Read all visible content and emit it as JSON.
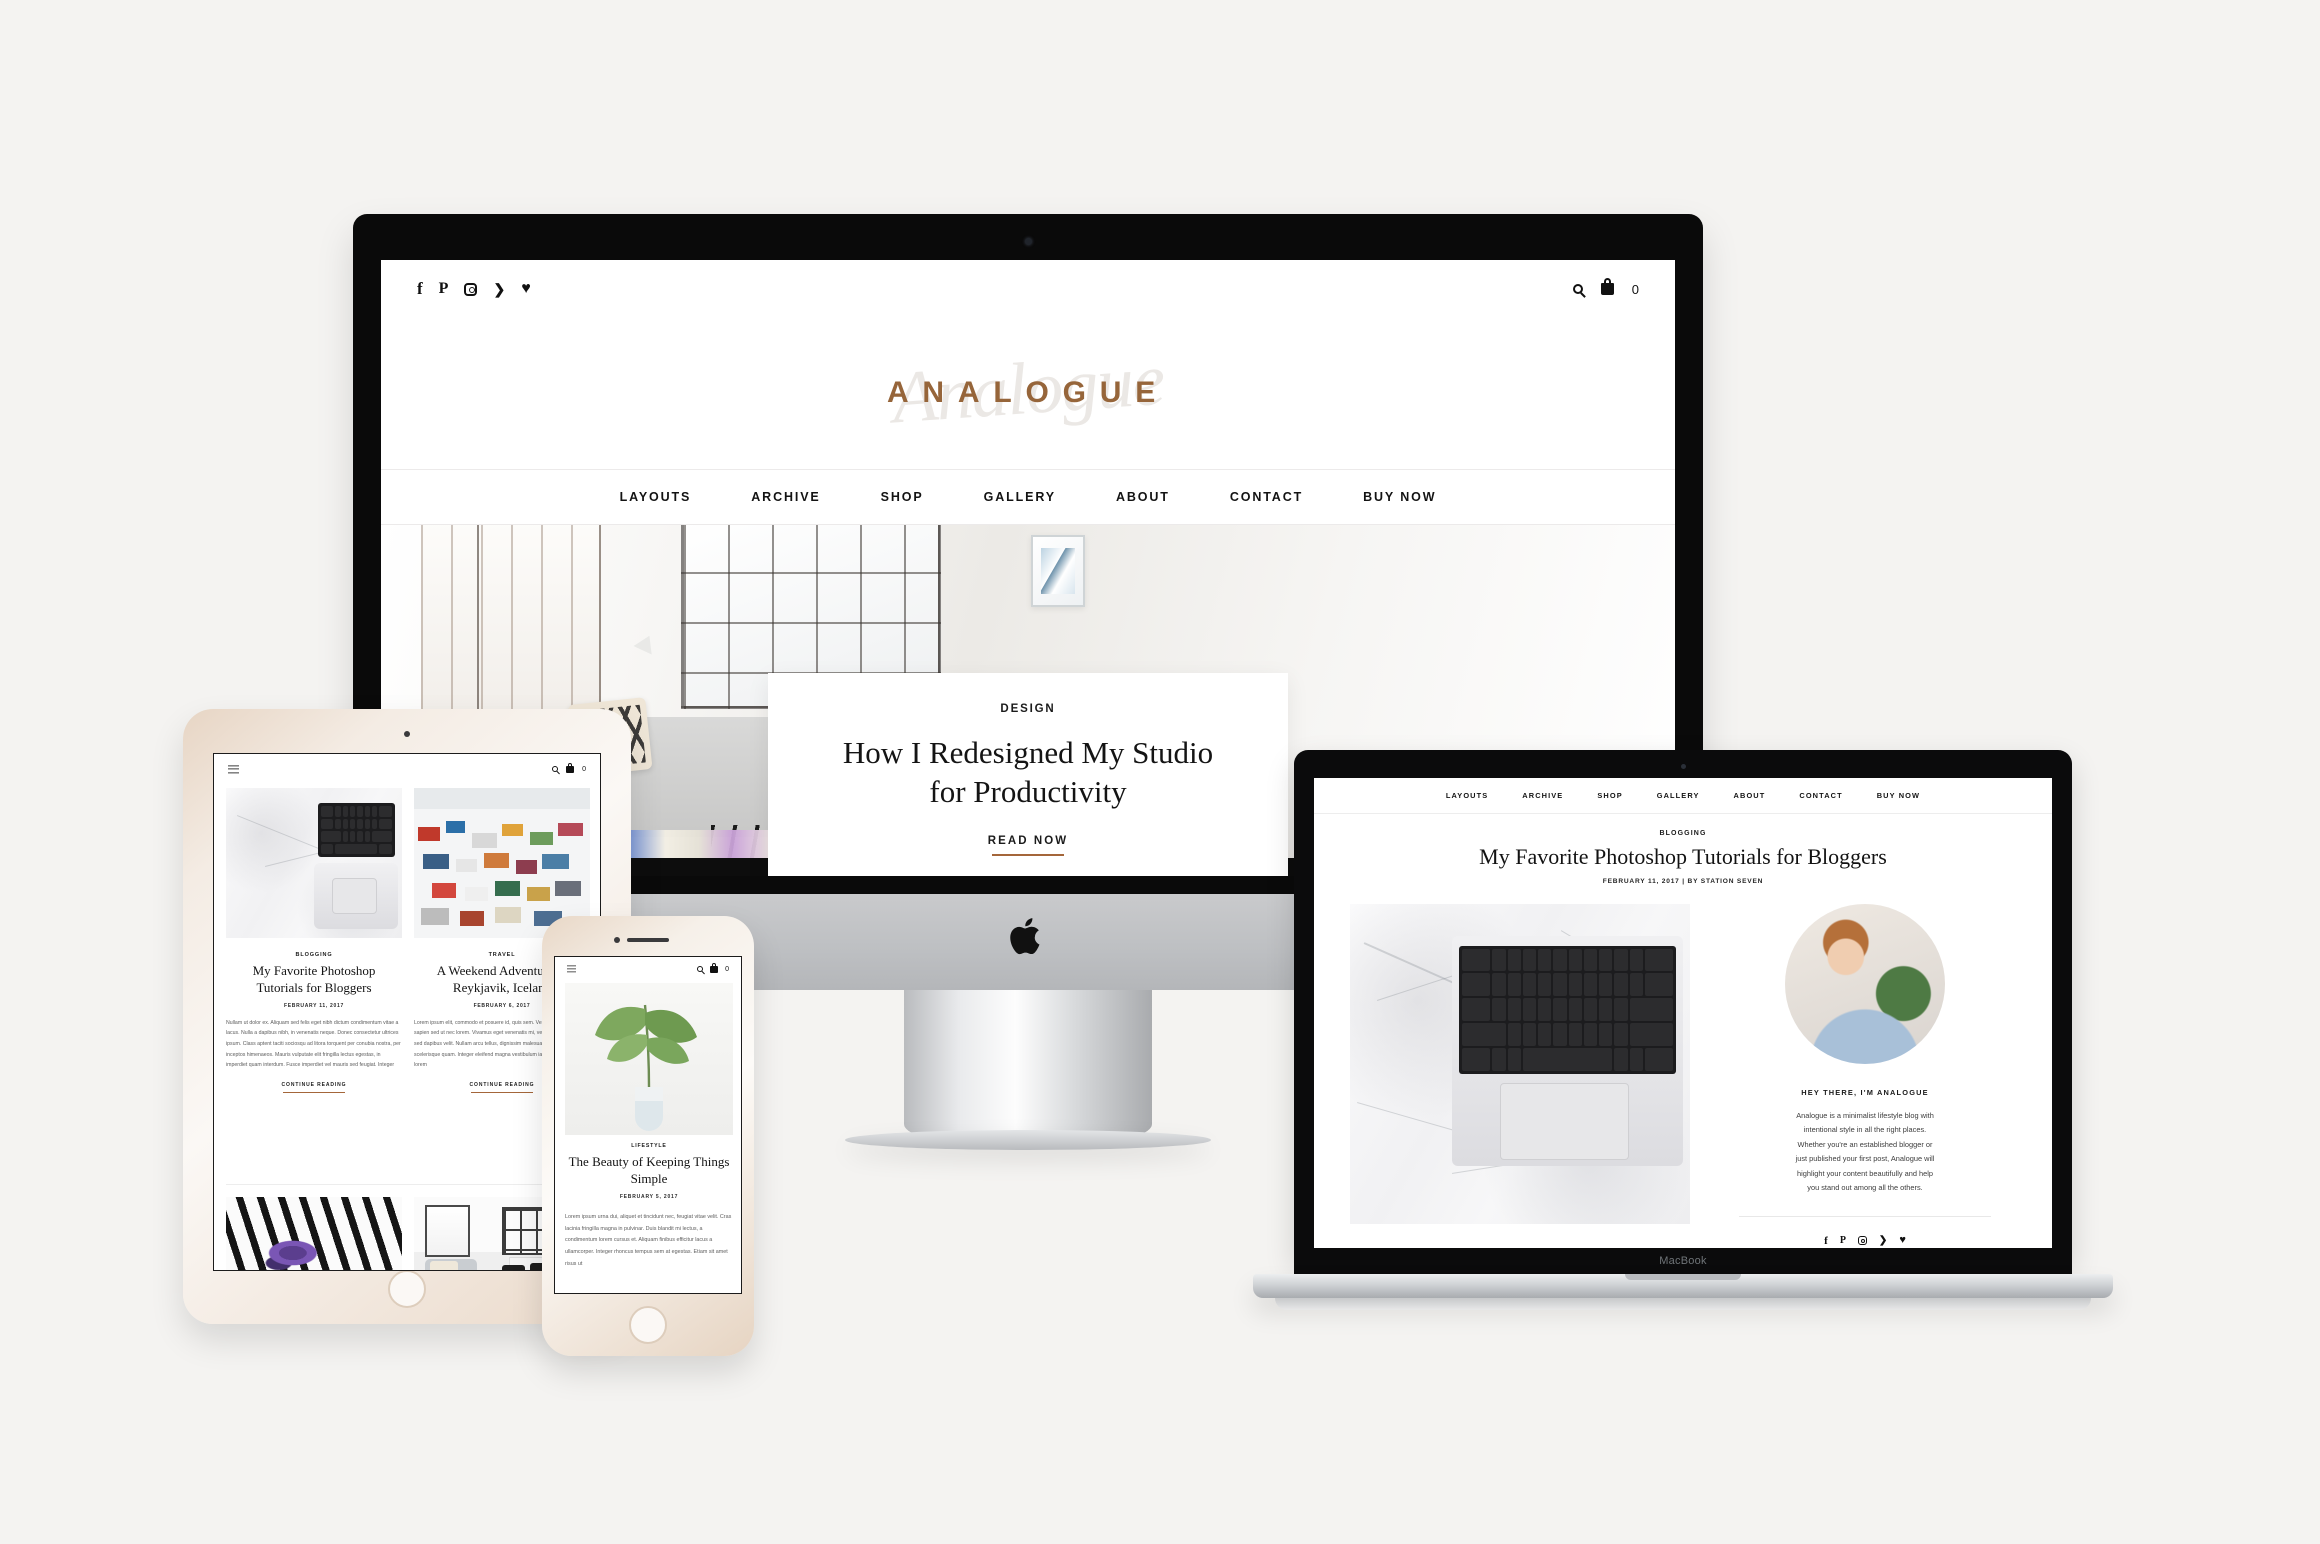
{
  "scene": {
    "background_color": "#f4f3f1",
    "devices": [
      "imac",
      "ipad",
      "iphone",
      "macbook"
    ]
  },
  "brand": {
    "logo_text": "ANALOGUE",
    "logo_script_text": "Analogue",
    "logo_color": "#96653a",
    "accent_color": "#a4663a"
  },
  "imac": {
    "device_label": "iMac",
    "social_icons": [
      "facebook-icon",
      "pinterest-icon",
      "instagram-icon",
      "twitter-icon",
      "heart-icon"
    ],
    "utility": {
      "search_icon": "search-icon",
      "cart_icon": "shopping-bag-icon",
      "cart_count": "0"
    },
    "nav": [
      "LAYOUTS",
      "ARCHIVE",
      "SHOP",
      "GALLERY",
      "ABOUT",
      "CONTACT",
      "BUY NOW"
    ],
    "hero": {
      "category": "DESIGN",
      "title_line_1": "How I Redesigned My Studio",
      "title_line_2": "for Productivity",
      "cta": "READ NOW",
      "image_alt": "bright loft studio with windows, sofa and patterned rug"
    }
  },
  "ipad": {
    "device_label": "iPad",
    "menu_icon": "hamburger-menu-icon",
    "utility": {
      "search_icon": "search-icon",
      "cart_icon": "shopping-bag-icon",
      "cart_count": "0"
    },
    "posts": [
      {
        "category": "BLOGGING",
        "title_line_1": "My Favorite Photoshop",
        "title_line_2": "Tutorials for Bloggers",
        "date": "FEBRUARY 11, 2017",
        "excerpt": "Nullam ut dolor ex. Aliquam sed felis eget nibh dictum condimentum vitae a lacus. Nulla a dapibus nibh, in venenatis neque. Donec consectetur ultrices ipsum. Class aptent taciti sociosqu ad litora torquent per conubia nostra, per inceptos himenaeos. Mauris vulputate elit fringilla lectus egestas, in imperdiet quam interdum. Fusce imperdiet vel mauris sed feugiat. Integer",
        "cta": "CONTINUE READING",
        "image_alt": "marble desk with laptop and notebook"
      },
      {
        "category": "TRAVEL",
        "title_line_1": "A Weekend Adventure in",
        "title_line_2": "Reykjavik, Iceland",
        "date": "FEBRUARY 6, 2017",
        "excerpt": "Lorem ipsum elit, commodo et posuere id, quis sem. Vestibulum ac felis a sapien sed ut nec lorem. Vivamus eget venenatis mi, vestibulum quam nulla, sed dapibus velit. Nullam arcu tellus, dignissim malesuada et pretium scelerisque quam. Integer eleifend magna vestibulum iaculis. Donec erat lorem",
        "cta": "CONTINUE READING",
        "image_alt": "colorful rooftops of Reykjavik"
      }
    ],
    "bottom_images": [
      {
        "image_alt": "woman in striped shirt holding purple flowers"
      },
      {
        "image_alt": "minimal dining room with black chairs"
      }
    ]
  },
  "iphone": {
    "device_label": "iPhone",
    "menu_icon": "hamburger-menu-icon",
    "utility": {
      "search_icon": "search-icon",
      "cart_icon": "shopping-bag-icon",
      "cart_count": "0"
    },
    "post": {
      "category": "LIFESTYLE",
      "title_line_1": "The Beauty of Keeping Things",
      "title_line_2": "Simple",
      "date": "FEBRUARY 5, 2017",
      "excerpt": "Lorem ipsum urna dui, aliquet et tincidunt nec, feugiat vitae velit. Cras lacinia fringilla magna in pulvinar. Duis blandit mi lectus, a condimentum lorem cursus et. Aliquam finibus efficitur lacus a ullamcorper. Integer rhoncus tempus sem at egestas. Etiam sit amet risus ut",
      "image_alt": "monstera leaf in a glass vase"
    }
  },
  "macbook": {
    "device_label": "MacBook",
    "case_label": "MacBook",
    "nav": [
      "LAYOUTS",
      "ARCHIVE",
      "SHOP",
      "GALLERY",
      "ABOUT",
      "CONTACT",
      "BUY NOW"
    ],
    "post": {
      "category": "BLOGGING",
      "title": "My Favorite Photoshop Tutorials for Bloggers",
      "meta": "FEBRUARY 11, 2017 | BY STATION SEVEN",
      "image_alt": "MacBook keyboard on white marble desk"
    },
    "sidebar": {
      "heading": "HEY THERE, I'M ANALOGUE",
      "bio_lines": [
        "Analogue is a minimalist lifestyle blog with",
        "intentional style in all the right places.",
        "Whether you're an established blogger or",
        "just published your first post, Analogue will",
        "highlight your content beautifully and help",
        "you stand out among all the others."
      ],
      "avatar_alt": "smiling woman in blue shirt next to a plant",
      "social_icons": [
        "facebook-icon",
        "pinterest-icon",
        "instagram-icon",
        "twitter-icon",
        "heart-icon"
      ]
    }
  }
}
